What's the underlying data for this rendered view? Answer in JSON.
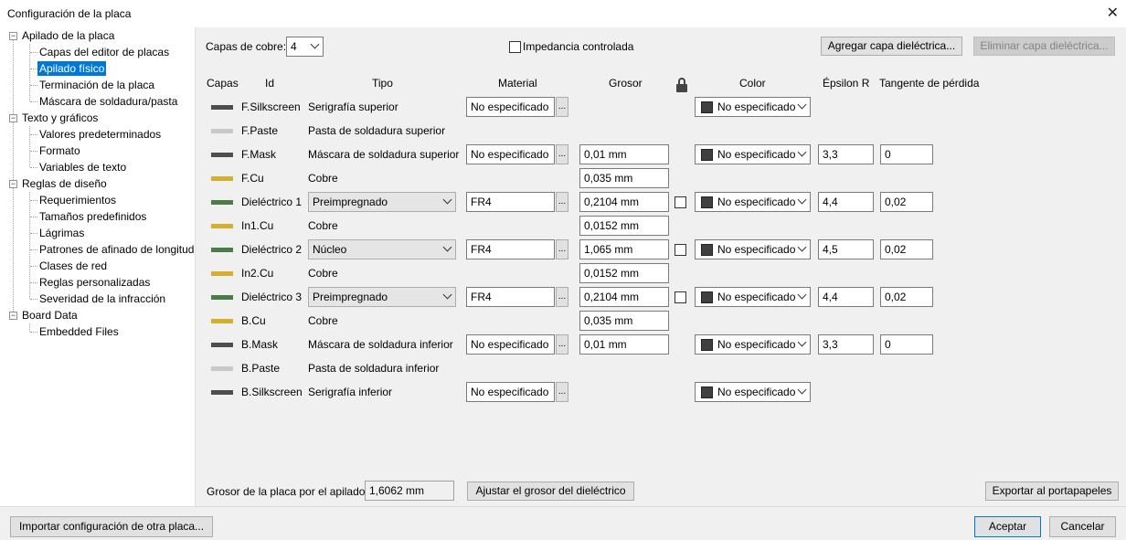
{
  "window": {
    "title": "Configuración de la placa",
    "close": "✕"
  },
  "tree": {
    "items": [
      {
        "label": "Apilado de la placa"
      },
      {
        "label": "Capas del editor de placas"
      },
      {
        "label": "Apilado físico"
      },
      {
        "label": "Terminación de la placa"
      },
      {
        "label": "Máscara de soldadura/pasta"
      },
      {
        "label": "Texto y gráficos"
      },
      {
        "label": "Valores predeterminados"
      },
      {
        "label": "Formato"
      },
      {
        "label": "Variables de texto"
      },
      {
        "label": "Reglas de diseño"
      },
      {
        "label": "Requerimientos"
      },
      {
        "label": "Tamaños predefinidos"
      },
      {
        "label": "Lágrimas"
      },
      {
        "label": "Patrones de afinado de longitud"
      },
      {
        "label": "Clases de red"
      },
      {
        "label": "Reglas personalizadas"
      },
      {
        "label": "Severidad de la infracción"
      },
      {
        "label": "Board Data"
      },
      {
        "label": "Embedded Files"
      }
    ],
    "toggle_symbol": "−"
  },
  "toolbar": {
    "copper_layers_label": "Capas de cobre:",
    "copper_layers_value": "4",
    "impedance_label": "Impedancia controlada",
    "add_dielectric": "Agregar capa dieléctrica...",
    "remove_dielectric": "Eliminar capa dieléctrica..."
  },
  "headers": {
    "layers": "Capas",
    "id": "Id",
    "type": "Tipo",
    "material": "Material",
    "thickness": "Grosor",
    "color": "Color",
    "epsilon": "Épsilon R",
    "loss": "Tangente de pérdida"
  },
  "rows": [
    {
      "id": "F.Silkscreen",
      "type": "Serigrafía superior",
      "material": "No especificado",
      "color": "No especificado",
      "swatch": "#4d4d4d"
    },
    {
      "id": "F.Paste",
      "type": "Pasta de soldadura superior",
      "swatch": "#c8c8c8"
    },
    {
      "id": "F.Mask",
      "type": "Máscara de soldadura superior",
      "material": "No especificado",
      "thickness": "0,01 mm",
      "color": "No especificado",
      "epsilon": "3,3",
      "loss": "0",
      "swatch": "#4d4d4d"
    },
    {
      "id": "F.Cu",
      "type": "Cobre",
      "thickness": "0,035 mm",
      "swatch": "#d4b02c"
    },
    {
      "id": "Dieléctrico 1",
      "type": "Preimpregnado",
      "material": "FR4",
      "thickness": "0,2104 mm",
      "color": "No especificado",
      "epsilon": "4,4",
      "loss": "0,02",
      "swatch": "#4a7c4a"
    },
    {
      "id": "In1.Cu",
      "type": "Cobre",
      "thickness": "0,0152 mm",
      "swatch": "#d4b02c"
    },
    {
      "id": "Dieléctrico 2",
      "type": "Núcleo",
      "material": "FR4",
      "thickness": "1,065 mm",
      "color": "No especificado",
      "epsilon": "4,5",
      "loss": "0,02",
      "swatch": "#4a7c4a"
    },
    {
      "id": "In2.Cu",
      "type": "Cobre",
      "thickness": "0,0152 mm",
      "swatch": "#d4b02c"
    },
    {
      "id": "Dieléctrico 3",
      "type": "Preimpregnado",
      "material": "FR4",
      "thickness": "0,2104 mm",
      "color": "No especificado",
      "epsilon": "4,4",
      "loss": "0,02",
      "swatch": "#4a7c4a"
    },
    {
      "id": "B.Cu",
      "type": "Cobre",
      "thickness": "0,035 mm",
      "swatch": "#d4b02c"
    },
    {
      "id": "B.Mask",
      "type": "Máscara de soldadura inferior",
      "material": "No especificado",
      "thickness": "0,01 mm",
      "color": "No especificado",
      "epsilon": "3,3",
      "loss": "0",
      "swatch": "#4d4d4d"
    },
    {
      "id": "B.Paste",
      "type": "Pasta de soldadura inferior",
      "swatch": "#c8c8c8"
    },
    {
      "id": "B.Silkscreen",
      "type": "Serigrafía inferior",
      "material": "No especificado",
      "color": "No especificado",
      "swatch": "#4d4d4d"
    }
  ],
  "dots_label": "...",
  "footer": {
    "board_thickness_label": "Grosor de la placa por el apilado:",
    "board_thickness_value": "1,6062 mm",
    "adjust_button": "Ajustar el grosor del dieléctrico",
    "export_button": "Exportar al portapapeles"
  },
  "bottom": {
    "import_button": "Importar configuración de otra placa...",
    "ok_button": "Aceptar",
    "cancel_button": "Cancelar"
  }
}
